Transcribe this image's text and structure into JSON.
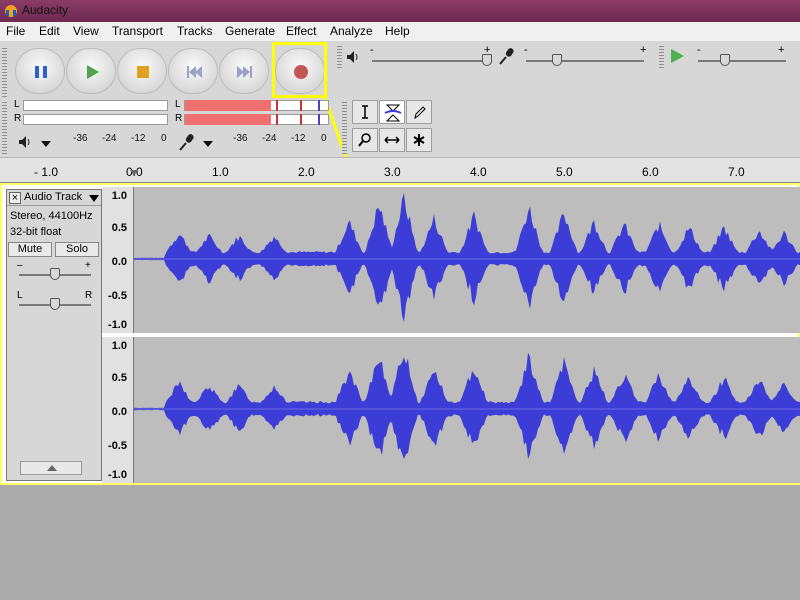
{
  "window": {
    "title": "Audacity"
  },
  "menu": [
    "File",
    "Edit",
    "View",
    "Transport",
    "Tracks",
    "Generate",
    "Effect",
    "Analyze",
    "Help"
  ],
  "transport": {
    "buttons": [
      "pause",
      "play",
      "stop",
      "skip-to-start",
      "skip-to-end",
      "record"
    ]
  },
  "meters": {
    "channel_left": "L",
    "channel_right": "R",
    "playback_ticks": [
      "-36",
      "-24",
      "-12",
      "0"
    ],
    "record_ticks": [
      "-36",
      "-24",
      "-12",
      "0"
    ],
    "record_level_left": 0.6,
    "record_level_right": 0.6
  },
  "mixer": {
    "output_minus": "-",
    "output_plus": "+",
    "input_minus": "-",
    "input_plus": "+",
    "speed_minus": "-",
    "speed_plus": "+"
  },
  "ruler": {
    "labels": [
      "- 1.0",
      "0.0",
      "1.0",
      "2.0",
      "3.0",
      "4.0",
      "5.0",
      "6.0",
      "7.0"
    ]
  },
  "track": {
    "name": "Audio Track",
    "rate": "Stereo, 44100Hz",
    "format": "32-bit float",
    "mute_label": "Mute",
    "solo_label": "Solo",
    "gain_minus": "–",
    "gain_plus": "+",
    "pan_left": "L",
    "pan_right": "R"
  },
  "vscale": {
    "top": [
      "1.0",
      "0.5",
      "0.0",
      "-0.5",
      "-1.0"
    ],
    "bottom": [
      "1.0",
      "0.5",
      "0.0",
      "-0.5",
      "-1.0"
    ]
  },
  "colors": {
    "waveform": "#3c3cd6",
    "highlight": "#ffff00",
    "meter": "#f07070"
  }
}
